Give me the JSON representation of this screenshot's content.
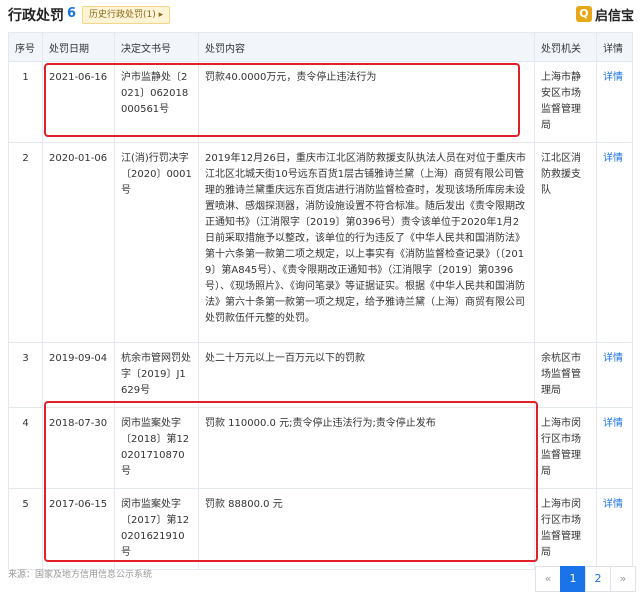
{
  "header": {
    "title": "行政处罚",
    "count": "6",
    "history_tag": "历史行政处罚(1) ▸",
    "logo_text": "启信宝",
    "logo_icon": "shield-logo-icon"
  },
  "columns": [
    "序号",
    "处罚日期",
    "决定文书号",
    "处罚内容",
    "处罚机关",
    "详情"
  ],
  "rows": [
    {
      "seq": "1",
      "date": "2021-06-16",
      "doc_no": "沪市监静处〔2021〕062018000561号",
      "content": "罚款40.0000万元，责令停止违法行为",
      "authority": "上海市静安区市场监督管理局",
      "detail": "详情"
    },
    {
      "seq": "2",
      "date": "2020-01-06",
      "doc_no": "江(消)行罚决字〔2020〕0001号",
      "content": "2019年12月26日，重庆市江北区消防救援支队执法人员在对位于重庆市江北区北城天街10号远东百货1层古铺雅诗兰黛（上海）商贸有限公司管理的雅诗兰黛重庆远东百货店进行消防监督检查时，发现该场所库房未设置喷淋、感烟探测器，消防设施设置不符合标准。随后发出《责令限期改正通知书》（江消限字〔2019〕第0396号）责令该单位于2020年1月2日前采取措施予以整改，该单位的行为违反了《中华人民共和国消防法》第十六条第一款第二项之规定，以上事实有《消防监督检查记录》（〔2019〕第A845号）、《责令限期改正通知书》（江消限字〔2019〕第0396号）、《现场照片》、《询问笔录》等证据证实。根据《中华人民共和国消防法》第六十条第一款第一项之规定，给予雅诗兰黛（上海）商贸有限公司处罚款伍仟元整的处罚。",
      "authority": "江北区消防救援支队",
      "detail": "详情"
    },
    {
      "seq": "3",
      "date": "2019-09-04",
      "doc_no": "杭余市管网罚处字〔2019〕J1629号",
      "content": "处二十万元以上一百万元以下的罚款",
      "authority": "余杭区市场监督管理局",
      "detail": "详情"
    },
    {
      "seq": "4",
      "date": "2018-07-30",
      "doc_no": "闵市监案处字〔2018〕第120201710870号",
      "content": "罚款 110000.0 元;责令停止违法行为;责令停止发布",
      "authority": "上海市闵行区市场监督管理局",
      "detail": "详情"
    },
    {
      "seq": "5",
      "date": "2017-06-15",
      "doc_no": "闵市监案处字〔2017〕第120201621910号",
      "content": "罚款 88800.0 元",
      "authority": "上海市闵行区市场监督管理局",
      "detail": "详情"
    }
  ],
  "footer": {
    "source": "来源：国家及地方信用信息公示系统",
    "pager": [
      "«",
      "1",
      "2",
      "»"
    ]
  },
  "colors": {
    "accent": "#1a73e8",
    "highlight": "#e2202a",
    "header_bg": "#f2f6fb"
  }
}
